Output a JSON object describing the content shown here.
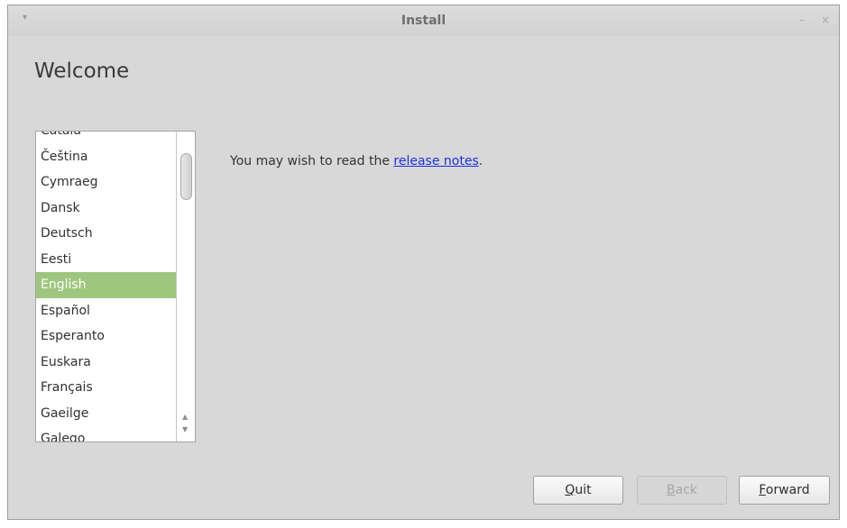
{
  "window": {
    "title": "Install",
    "menu_glyph": "▾",
    "minimize_glyph": "–",
    "close_glyph": "×"
  },
  "page": {
    "heading": "Welcome"
  },
  "languages": {
    "items": [
      "Català",
      "Čeština",
      "Cymraeg",
      "Dansk",
      "Deutsch",
      "Eesti",
      "English",
      "Español",
      "Esperanto",
      "Euskara",
      "Français",
      "Gaeilge",
      "Galego"
    ],
    "selected": "English"
  },
  "release_notes": {
    "prefix": "You may wish to read the ",
    "link_text": "release notes",
    "suffix": "."
  },
  "buttons": {
    "quit": {
      "mnemonic": "Q",
      "rest": "uit"
    },
    "back": {
      "mnemonic": "B",
      "rest": "ack"
    },
    "forward": {
      "mnemonic": "F",
      "rest": "orward"
    }
  },
  "colors": {
    "selection": "#9fc67e",
    "link": "#1e2fe0",
    "window_bg": "#d8d8d8"
  }
}
